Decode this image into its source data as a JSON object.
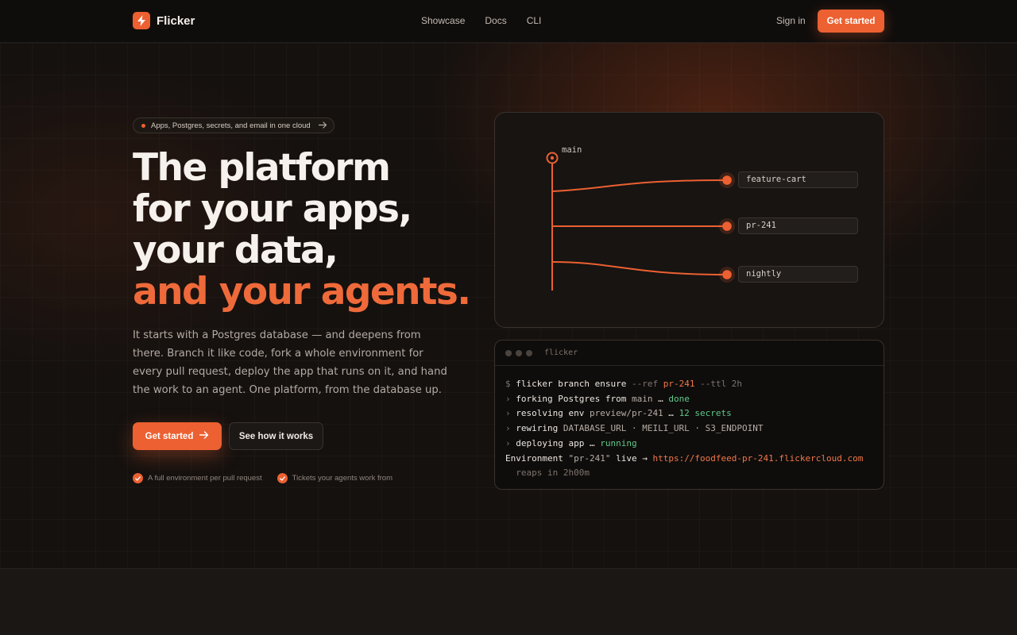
{
  "colors": {
    "accent": "#ec6031",
    "accent_text": "#ef6a3a",
    "success": "#5ec98a",
    "background": "#141110"
  },
  "nav": {
    "brand": "Flicker",
    "brand_icon": "lightning-bolt-icon",
    "links": [
      "Showcase",
      "Docs",
      "CLI"
    ],
    "sign_in": "Sign in",
    "cta": "Get started"
  },
  "hero": {
    "announcement": "Apps, Postgres, secrets, and email in one cloud",
    "headline_lines": [
      "The platform",
      "for your apps,",
      "your data,"
    ],
    "headline_accent": "and your agents.",
    "lede": "It starts with a Postgres database — and deepens from there. Branch it like code, fork a whole environment for every pull request, deploy the app that runs on it, and hand the work to an agent. One platform, from the database up.",
    "primary_cta": "Get started",
    "secondary_cta": "See how it works",
    "checks": [
      "A full environment per pull request",
      "Tickets your agents work from"
    ]
  },
  "diagram": {
    "root_branch": "main",
    "branches": [
      "feature-cart",
      "pr-241",
      "nightly"
    ]
  },
  "terminal": {
    "title": "flicker",
    "lines": [
      [
        {
          "t": "$ ",
          "c": "t-dim"
        },
        {
          "t": "flicker branch ensure "
        },
        {
          "t": "--ref ",
          "c": "t-dim"
        },
        {
          "t": "pr-241",
          "c": "t-orange"
        },
        {
          "t": " --ttl 2h",
          "c": "t-dim"
        }
      ],
      [
        {
          "t": "› ",
          "c": "t-dim"
        },
        {
          "t": "forking Postgres from "
        },
        {
          "t": "main",
          "c": "t-muted"
        },
        {
          "t": " … "
        },
        {
          "t": "done",
          "c": "t-green"
        }
      ],
      [
        {
          "t": "› ",
          "c": "t-dim"
        },
        {
          "t": "resolving env "
        },
        {
          "t": "preview/pr-241",
          "c": "t-muted"
        },
        {
          "t": " … "
        },
        {
          "t": "12 secrets",
          "c": "t-green"
        }
      ],
      [
        {
          "t": "› ",
          "c": "t-dim"
        },
        {
          "t": "rewiring "
        },
        {
          "t": "DATABASE_URL · MEILI_URL · S3_ENDPOINT",
          "c": "t-muted"
        }
      ],
      [
        {
          "t": "› ",
          "c": "t-dim"
        },
        {
          "t": "deploying app … "
        },
        {
          "t": "running",
          "c": "t-green"
        }
      ],
      [
        {
          "t": "Environment "
        },
        {
          "t": "\"pr-241\"",
          "c": "t-muted"
        },
        {
          "t": " live → "
        },
        {
          "t": "https://foodfeed-pr-241.flickercloud.com",
          "c": "t-url"
        }
      ],
      [
        {
          "t": "  reaps in 2h00m",
          "c": "t-dim"
        }
      ]
    ]
  }
}
